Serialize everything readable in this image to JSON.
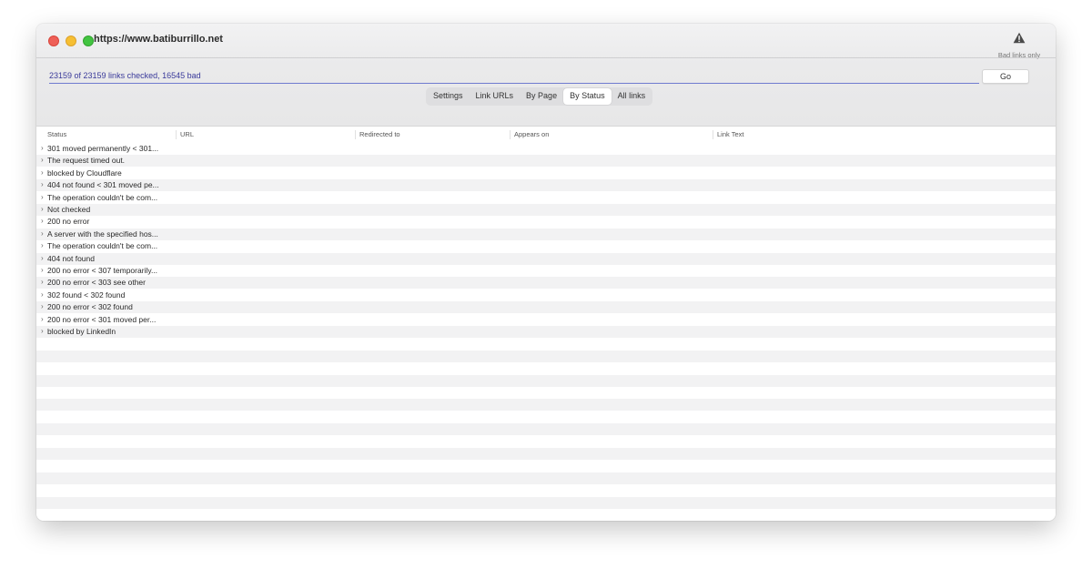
{
  "window": {
    "title": "https://www.batiburrillo.net",
    "bad_links_label": "Bad links only"
  },
  "progress": {
    "text": "23159 of 23159 links checked, 16545 bad",
    "go_label": "Go"
  },
  "tabs": [
    {
      "label": "Settings",
      "active": false
    },
    {
      "label": "Link URLs",
      "active": false
    },
    {
      "label": "By Page",
      "active": false
    },
    {
      "label": "By Status",
      "active": true
    },
    {
      "label": "All links",
      "active": false
    }
  ],
  "table": {
    "columns": [
      "Status",
      "URL",
      "Redirected to",
      "Appears on",
      "Link Text"
    ],
    "rows": [
      "301 moved permanently < 301...",
      "The request timed out.",
      "blocked by Cloudflare",
      "404 not found < 301 moved pe...",
      "The operation couldn't be com...",
      "Not checked",
      "200 no error",
      "A server with the specified hos...",
      "The operation couldn't be com...",
      "404 not found",
      "200 no error < 307 temporarily...",
      "200 no error < 303 see other",
      "302 found < 302 found",
      "200 no error < 302 found",
      "200 no error < 301 moved per...",
      "blocked by LinkedIn"
    ]
  },
  "colors": {
    "accent_line": "#6f7bd0",
    "close": "#ee5f57",
    "minimize": "#f6bf33",
    "zoom": "#42c441"
  }
}
